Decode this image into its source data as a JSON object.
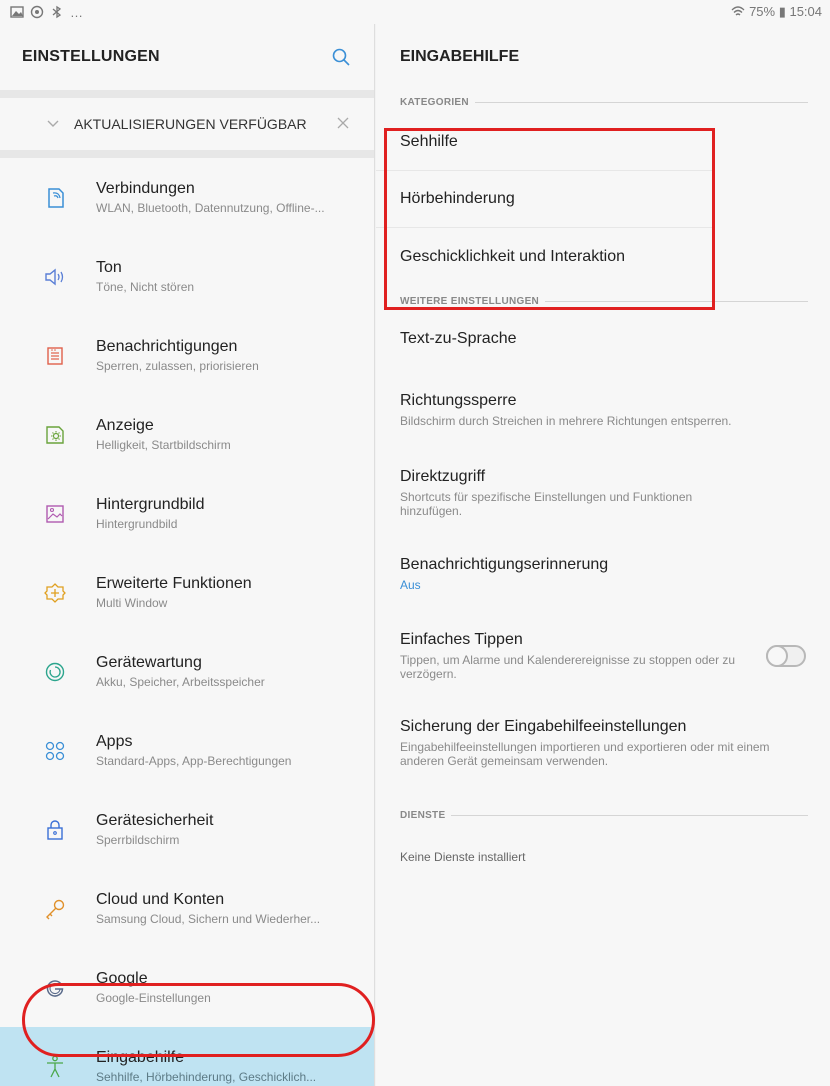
{
  "status": {
    "right_text": "75% ▮ 15:04"
  },
  "left": {
    "title": "EINSTELLUNGEN",
    "updates_label": "AKTUALISIERUNGEN VERFÜGBAR",
    "items": [
      {
        "title": "Verbindungen",
        "subtitle": "WLAN, Bluetooth, Datennutzung, Offline-...",
        "icon": "connections-icon",
        "color": "#3a8fd6"
      },
      {
        "title": "Ton",
        "subtitle": "Töne, Nicht stören",
        "icon": "sound-icon",
        "color": "#5a7fd6"
      },
      {
        "title": "Benachrichtigungen",
        "subtitle": "Sperren, zulassen, priorisieren",
        "icon": "notifications-icon",
        "color": "#e0604a"
      },
      {
        "title": "Anzeige",
        "subtitle": "Helligkeit, Startbildschirm",
        "icon": "display-icon",
        "color": "#6aa43c"
      },
      {
        "title": "Hintergrundbild",
        "subtitle": "Hintergrundbild",
        "icon": "wallpaper-icon",
        "color": "#b05ab0"
      },
      {
        "title": "Erweiterte Funktionen",
        "subtitle": "Multi Window",
        "icon": "advanced-features-icon",
        "color": "#e0a020"
      },
      {
        "title": "Gerätewartung",
        "subtitle": "Akku, Speicher, Arbeitsspeicher",
        "icon": "device-maintenance-icon",
        "color": "#2ca58d"
      },
      {
        "title": "Apps",
        "subtitle": "Standard-Apps, App-Berechtigungen",
        "icon": "apps-icon",
        "color": "#3a8fd6"
      },
      {
        "title": "Gerätesicherheit",
        "subtitle": "Sperrbildschirm",
        "icon": "lock-icon",
        "color": "#3a6fd6"
      },
      {
        "title": "Cloud und Konten",
        "subtitle": "Samsung Cloud, Sichern und Wiederher...",
        "icon": "key-icon",
        "color": "#e0902a"
      },
      {
        "title": "Google",
        "subtitle": "Google-Einstellungen",
        "icon": "google-icon",
        "color": "#5a6a8a"
      },
      {
        "title": "Eingabehilfe",
        "subtitle": "Sehhilfe, Hörbehinderung, Geschicklich...",
        "icon": "accessibility-icon",
        "color": "#4aa84a"
      }
    ]
  },
  "right": {
    "title": "EINGABEHILFE",
    "kategorien_label": "KATEGORIEN",
    "categories": [
      "Sehhilfe",
      "Hörbehinderung",
      "Geschicklichkeit und Interaktion"
    ],
    "weitere_label": "WEITERE EINSTELLUNGEN",
    "weitere": {
      "tts": "Text-zu-Sprache",
      "richtung_title": "Richtungssperre",
      "richtung_sub": "Bildschirm durch Streichen in mehrere Richtungen entsperren.",
      "direkt_title": "Direktzugriff",
      "direkt_sub": "Shortcuts für spezifische Einstellungen und Funktionen hinzufügen.",
      "benach_title": "Benachrichtigungserinnerung",
      "benach_sub": "Aus",
      "tippen_title": "Einfaches Tippen",
      "tippen_sub": "Tippen, um Alarme und Kalenderereignisse zu stoppen oder zu verzögern.",
      "sicherung_title": "Sicherung der Eingabehilfeeinstellungen",
      "sicherung_sub": "Eingabehilfeeinstellungen importieren und exportieren oder mit einem anderen Gerät gemeinsam verwenden."
    },
    "dienste_label": "DIENSTE",
    "dienste_empty": "Keine Dienste installiert"
  }
}
